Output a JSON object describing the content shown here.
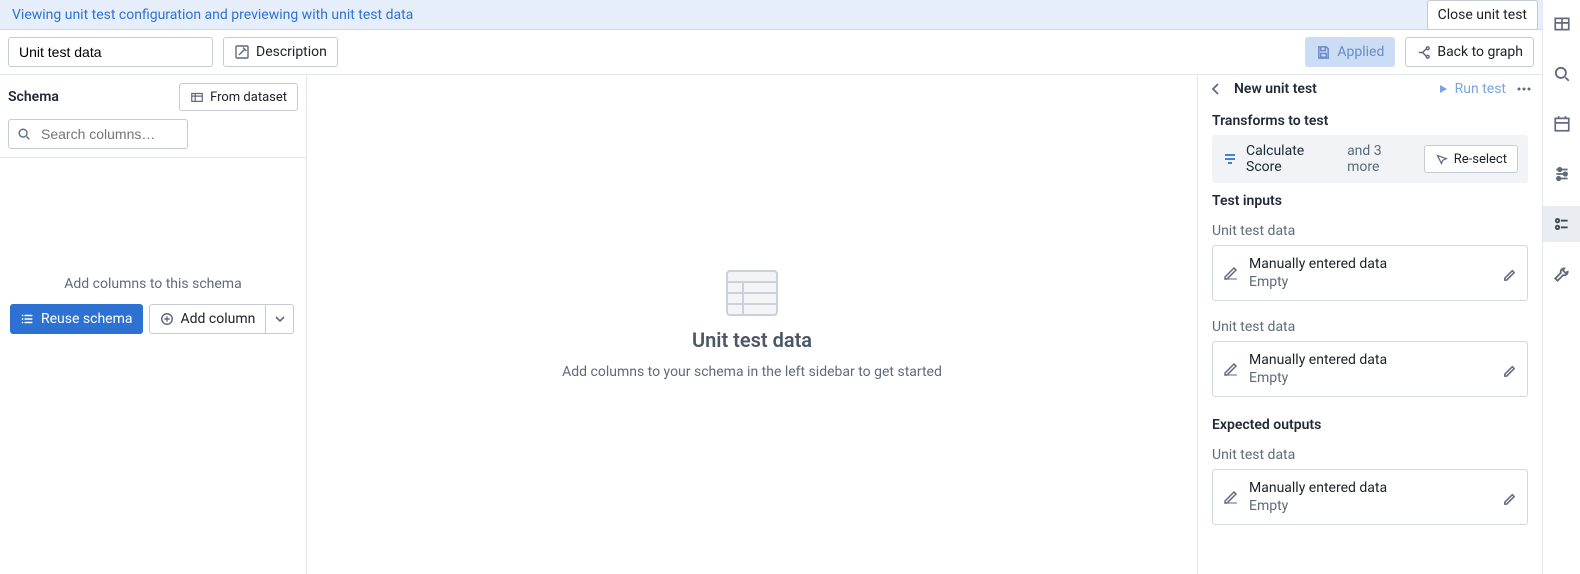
{
  "banner": {
    "message": "Viewing unit test configuration and previewing with unit test data",
    "close_label": "Close unit test"
  },
  "toolbar": {
    "name_value": "Unit test data",
    "description_label": "Description",
    "applied_label": "Applied",
    "back_to_graph_label": "Back to graph"
  },
  "schema": {
    "title": "Schema",
    "from_dataset_label": "From dataset",
    "search_placeholder": "Search columns…",
    "empty_message": "Add columns to this schema",
    "reuse_label": "Reuse schema",
    "add_column_label": "Add column"
  },
  "canvas": {
    "title": "Unit test data",
    "subtitle": "Add columns to your schema in the left sidebar to get started"
  },
  "testpanel": {
    "title": "New unit test",
    "run_label": "Run test",
    "sections": {
      "transforms_title": "Transforms to test",
      "transforms_name": "Calculate Score",
      "transforms_more": "and 3 more",
      "reselect_label": "Re-select",
      "inputs_title": "Test inputs",
      "outputs_title": "Expected outputs"
    },
    "inputs": [
      {
        "label": "Unit test data",
        "kind": "Manually entered data",
        "status": "Empty"
      },
      {
        "label": "Unit test data",
        "kind": "Manually entered data",
        "status": "Empty"
      }
    ],
    "outputs": [
      {
        "label": "Unit test data",
        "kind": "Manually entered data",
        "status": "Empty"
      }
    ]
  }
}
